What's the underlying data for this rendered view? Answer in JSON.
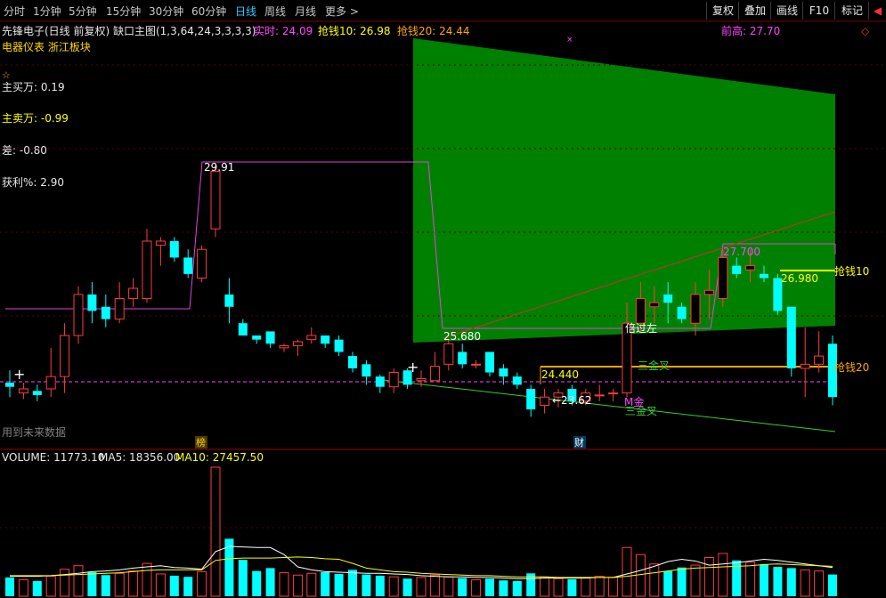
{
  "toolbar": {
    "periods": [
      "分时",
      "1分钟",
      "5分钟",
      "15分钟",
      "30分钟",
      "60分钟",
      "日线",
      "周线",
      "月线",
      "更多 >"
    ],
    "active_period": "日线",
    "right_buttons": [
      "复权",
      "叠加",
      "画线",
      "F10",
      "标记"
    ],
    "right_arrow": "◀"
  },
  "header": {
    "title": "先锋电子(日线 前复权) 缺口主图(1,3,64,24,3,3,3,3)",
    "realtime": "实时: 24.09",
    "qiangqian10": "抢钱10: 26.98",
    "qiangqian20": "抢钱20: 24.44",
    "qiangao": "前高: 27.70",
    "sector": "电器仪表 浙江板块",
    "diamond_icon": "◇"
  },
  "indicators": {
    "star": "☆",
    "buy": "主买万: 0.19",
    "sell": "主卖万: -0.99",
    "diff": "差: -0.80",
    "profit": "获利%: 2.90"
  },
  "chart_labels": {
    "peak": "29.91",
    "gap_left": "25.680",
    "level_24": "24.440",
    "low": "←23.62",
    "peak_right": "27.700",
    "level_26": "26.980",
    "qiangqian10": "抢钱10",
    "qiangqian20": "抢钱20",
    "beiguozuo": "倍过左",
    "jincha1": "三金叉",
    "jincha2": "三金叉",
    "mjin": "M金",
    "future_data": "用到未来数据",
    "bang_badge": "榜",
    "cai_badge": "财"
  },
  "volume": {
    "volume": "VOLUME: 11773.10",
    "ma5": "MA5: 18356.00",
    "ma10": "MA10: 27457.50"
  },
  "colors": {
    "up": "#ff3c3c",
    "down": "#00ffff",
    "magenta": "#ff44ff",
    "yellow": "#ffff00",
    "orange": "#ffa500",
    "green_area": "#008000",
    "accent_blue": "#36c6ff"
  },
  "chart_data": {
    "type": "candlestick",
    "price_range": [
      22.5,
      31.0
    ],
    "candles": [
      {
        "o": 24.45,
        "c": 24.35,
        "h": 24.75,
        "l": 24.1
      },
      {
        "o": 24.2,
        "c": 24.3,
        "h": 24.45,
        "l": 24.05
      },
      {
        "o": 24.25,
        "c": 24.15,
        "h": 24.4,
        "l": 24.0
      },
      {
        "o": 24.3,
        "c": 24.6,
        "h": 25.3,
        "l": 24.1
      },
      {
        "o": 24.6,
        "c": 25.6,
        "h": 25.9,
        "l": 24.2
      },
      {
        "o": 25.6,
        "c": 26.6,
        "h": 26.8,
        "l": 25.4
      },
      {
        "o": 26.6,
        "c": 26.2,
        "h": 26.9,
        "l": 25.9
      },
      {
        "o": 26.3,
        "c": 26.0,
        "h": 26.6,
        "l": 25.8
      },
      {
        "o": 26.0,
        "c": 26.5,
        "h": 26.9,
        "l": 25.9
      },
      {
        "o": 26.5,
        "c": 26.75,
        "h": 27.0,
        "l": 26.3
      },
      {
        "o": 26.5,
        "c": 27.9,
        "h": 28.2,
        "l": 26.4
      },
      {
        "o": 27.8,
        "c": 27.9,
        "h": 28.0,
        "l": 27.3
      },
      {
        "o": 27.9,
        "c": 27.5,
        "h": 28.0,
        "l": 27.4
      },
      {
        "o": 27.5,
        "c": 27.1,
        "h": 27.7,
        "l": 27.0
      },
      {
        "o": 27.0,
        "c": 27.7,
        "h": 27.8,
        "l": 26.9
      },
      {
        "o": 28.2,
        "c": 29.6,
        "h": 29.8,
        "l": 28.0
      },
      {
        "o": 26.6,
        "c": 26.3,
        "h": 27.0,
        "l": 25.9
      },
      {
        "o": 25.9,
        "c": 25.6,
        "h": 26.0,
        "l": 25.6
      },
      {
        "o": 25.6,
        "c": 25.5,
        "h": 25.6,
        "l": 25.4
      },
      {
        "o": 25.7,
        "c": 25.4,
        "h": 25.7,
        "l": 25.3
      },
      {
        "o": 25.3,
        "c": 25.35,
        "h": 25.4,
        "l": 25.2
      },
      {
        "o": 25.35,
        "c": 25.45,
        "h": 25.5,
        "l": 25.1
      },
      {
        "o": 25.5,
        "c": 25.6,
        "h": 25.8,
        "l": 25.4
      },
      {
        "o": 25.6,
        "c": 25.4,
        "h": 25.6,
        "l": 25.3
      },
      {
        "o": 25.5,
        "c": 25.2,
        "h": 25.6,
        "l": 25.1
      },
      {
        "o": 25.1,
        "c": 24.8,
        "h": 25.2,
        "l": 24.7
      },
      {
        "o": 24.9,
        "c": 24.6,
        "h": 25.0,
        "l": 24.4
      },
      {
        "o": 24.6,
        "c": 24.35,
        "h": 24.65,
        "l": 24.2
      },
      {
        "o": 24.35,
        "c": 24.7,
        "h": 24.8,
        "l": 24.2
      },
      {
        "o": 24.75,
        "c": 24.4,
        "h": 24.8,
        "l": 24.3
      },
      {
        "o": 24.5,
        "c": 24.55,
        "h": 24.75,
        "l": 24.35
      },
      {
        "o": 24.5,
        "c": 24.85,
        "h": 25.2,
        "l": 24.5
      },
      {
        "o": 24.9,
        "c": 25.4,
        "h": 25.5,
        "l": 24.75
      },
      {
        "o": 25.2,
        "c": 24.9,
        "h": 25.4,
        "l": 24.8
      },
      {
        "o": 24.9,
        "c": 24.9,
        "h": 25.0,
        "l": 24.8
      },
      {
        "o": 25.2,
        "c": 24.7,
        "h": 25.2,
        "l": 24.6
      },
      {
        "o": 24.8,
        "c": 24.6,
        "h": 24.9,
        "l": 24.4
      },
      {
        "o": 24.6,
        "c": 24.4,
        "h": 24.7,
        "l": 24.3
      },
      {
        "o": 24.3,
        "c": 23.8,
        "h": 24.4,
        "l": 23.62
      },
      {
        "o": 23.9,
        "c": 24.1,
        "h": 24.3,
        "l": 23.7
      },
      {
        "o": 24.1,
        "c": 24.2,
        "h": 24.3,
        "l": 23.85
      },
      {
        "o": 24.3,
        "c": 24.0,
        "h": 24.4,
        "l": 23.9
      },
      {
        "o": 24.0,
        "c": 24.2,
        "h": 24.3,
        "l": 23.9
      },
      {
        "o": 24.15,
        "c": 24.15,
        "h": 24.4,
        "l": 24.0
      },
      {
        "o": 24.2,
        "c": 24.2,
        "h": 24.3,
        "l": 24.0
      },
      {
        "o": 24.2,
        "c": 25.9,
        "h": 26.4,
        "l": 24.1
      },
      {
        "o": 25.9,
        "c": 26.5,
        "h": 26.9,
        "l": 25.7
      },
      {
        "o": 26.3,
        "c": 26.4,
        "h": 26.8,
        "l": 25.9
      },
      {
        "o": 26.6,
        "c": 26.4,
        "h": 26.9,
        "l": 25.9
      },
      {
        "o": 26.3,
        "c": 26.0,
        "h": 26.4,
        "l": 25.9
      },
      {
        "o": 25.9,
        "c": 26.6,
        "h": 26.9,
        "l": 25.6
      },
      {
        "o": 26.6,
        "c": 26.7,
        "h": 27.2,
        "l": 26.0
      },
      {
        "o": 26.5,
        "c": 27.5,
        "h": 27.7,
        "l": 26.3
      },
      {
        "o": 27.3,
        "c": 27.1,
        "h": 27.5,
        "l": 27.0
      },
      {
        "o": 27.2,
        "c": 27.3,
        "h": 27.7,
        "l": 26.9
      },
      {
        "o": 27.1,
        "c": 27.0,
        "h": 27.3,
        "l": 26.9
      },
      {
        "o": 27.0,
        "c": 26.2,
        "h": 27.1,
        "l": 26.1
      },
      {
        "o": 26.3,
        "c": 24.8,
        "h": 26.3,
        "l": 24.6
      },
      {
        "o": 24.8,
        "c": 24.9,
        "h": 25.8,
        "l": 24.1
      },
      {
        "o": 24.9,
        "c": 25.1,
        "h": 25.7,
        "l": 24.7
      },
      {
        "o": 25.4,
        "c": 24.1,
        "h": 25.6,
        "l": 23.9
      }
    ],
    "volume": [
      3200,
      2800,
      2600,
      3400,
      4600,
      5200,
      4100,
      3600,
      3900,
      4300,
      5600,
      3800,
      3500,
      3300,
      4200,
      22000,
      9800,
      6200,
      4300,
      4800,
      4000,
      3600,
      3900,
      4100,
      3800,
      4500,
      3700,
      3500,
      3300,
      3000,
      3200,
      3600,
      3300,
      3100,
      2800,
      3000,
      2700,
      2600,
      3900,
      3300,
      3000,
      2900,
      3100,
      3400,
      3200,
      8300,
      7100,
      5500,
      4300,
      4900,
      5300,
      6600,
      7300,
      6100,
      5800,
      5400,
      5000,
      4800,
      4500,
      4300,
      3700
    ],
    "ma5": [
      3400,
      3400,
      3400,
      3500,
      3700,
      3900,
      4200,
      4300,
      4500,
      4800,
      5000,
      5200,
      4900,
      4800,
      4600,
      7600,
      8500,
      8400,
      8300,
      8300,
      7100,
      5000,
      4500,
      4200,
      4100,
      4000,
      3900,
      3900,
      3800,
      3700,
      3500,
      3400,
      3300,
      3300,
      3200,
      3200,
      3100,
      3000,
      3000,
      3100,
      3100,
      3100,
      3100,
      3200,
      3200,
      3800,
      4400,
      5100,
      5900,
      6300,
      6000,
      5300,
      5500,
      5700,
      6000,
      6300,
      6100,
      5800,
      5500,
      5200,
      4900
    ],
    "ma10": [
      3500,
      3500,
      3500,
      3500,
      3600,
      3700,
      3800,
      3900,
      4000,
      4200,
      4400,
      4500,
      4500,
      4500,
      4500,
      6100,
      6400,
      6500,
      6500,
      6500,
      6600,
      6700,
      6600,
      6400,
      6300,
      5600,
      4800,
      4500,
      4200,
      4100,
      3900,
      3800,
      3700,
      3600,
      3500,
      3500,
      3400,
      3300,
      3300,
      3300,
      3200,
      3200,
      3200,
      3200,
      3200,
      3400,
      3700,
      4000,
      4300,
      4600,
      4800,
      4900,
      5000,
      5100,
      5200,
      5400,
      5500,
      5400,
      5300,
      5200,
      5100
    ]
  }
}
